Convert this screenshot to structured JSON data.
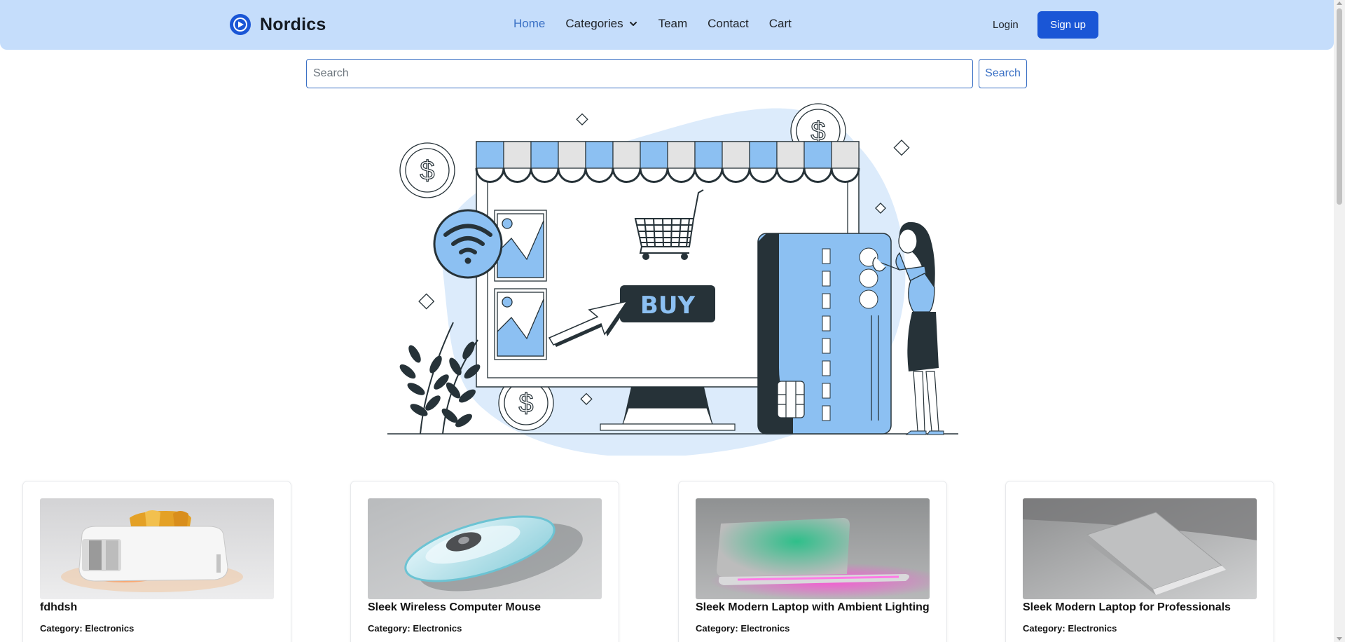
{
  "brand": {
    "name": "Nordics",
    "logo_icon": "play-circle-icon",
    "accent": "#1a56d6"
  },
  "nav": {
    "items": [
      {
        "label": "Home",
        "active": true
      },
      {
        "label": "Categories",
        "has_dropdown": true
      },
      {
        "label": "Team"
      },
      {
        "label": "Contact"
      },
      {
        "label": "Cart"
      }
    ],
    "login_label": "Login",
    "signup_label": "Sign up"
  },
  "search": {
    "placeholder": "Search",
    "value": "",
    "button_label": "Search"
  },
  "hero": {
    "illustration": "online-store-illustration",
    "buy_label": "BUY"
  },
  "products": [
    {
      "title": "fdhdsh",
      "category_label": "Category:",
      "category": "Electronics",
      "image": "toaster-image"
    },
    {
      "title": "Sleek Wireless Computer Mouse",
      "category_label": "Category:",
      "category": "Electronics",
      "image": "mouse-image"
    },
    {
      "title": "Sleek Modern Laptop with Ambient Lighting",
      "category_label": "Category:",
      "category": "Electronics",
      "image": "laptop-ambient-image"
    },
    {
      "title": "Sleek Modern Laptop for Professionals",
      "category_label": "Category:",
      "category": "Electronics",
      "image": "laptop-pro-image"
    }
  ],
  "colors": {
    "navbar_bg": "#c5ddfb",
    "link_active": "#3b71c5",
    "illustration_blue": "#8cc0f2",
    "illustration_dark": "#263238"
  }
}
